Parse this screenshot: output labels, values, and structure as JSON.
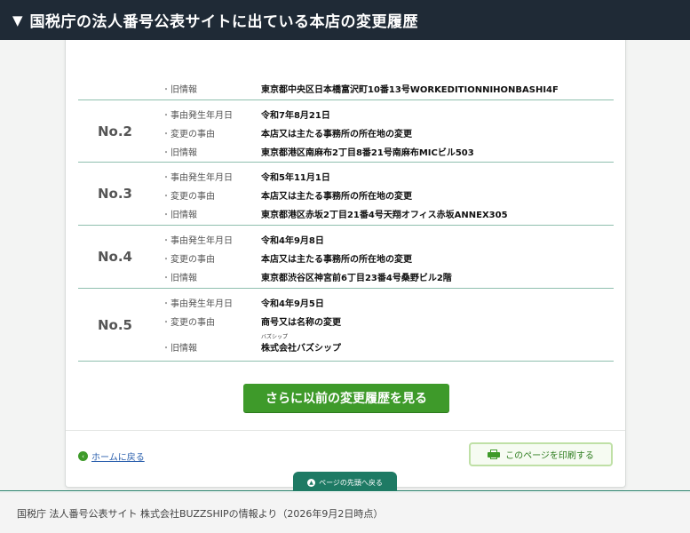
{
  "header": {
    "triangle": "▼",
    "title": "国税庁の法人番号公表サイトに出ている本店の変更履歴"
  },
  "records": [
    {
      "no": "",
      "fields": [
        {
          "label": "旧情報",
          "value": "東京都中央区日本橋富沢町10番13号WORKEDITIONNIHONBASHI4F"
        }
      ]
    },
    {
      "no": "No.2",
      "fields": [
        {
          "label": "事由発生年月日",
          "value": "令和7年8月21日"
        },
        {
          "label": "変更の事由",
          "value": "本店又は主たる事務所の所在地の変更"
        },
        {
          "label": "旧情報",
          "value": "東京都港区南麻布2丁目8番21号南麻布MICビル503"
        }
      ]
    },
    {
      "no": "No.3",
      "fields": [
        {
          "label": "事由発生年月日",
          "value": "令和5年11月1日"
        },
        {
          "label": "変更の事由",
          "value": "本店又は主たる事務所の所在地の変更"
        },
        {
          "label": "旧情報",
          "value": "東京都港区赤坂2丁目21番4号天翔オフィス赤坂ANNEX305"
        }
      ]
    },
    {
      "no": "No.4",
      "fields": [
        {
          "label": "事由発生年月日",
          "value": "令和4年9月8日"
        },
        {
          "label": "変更の事由",
          "value": "本店又は主たる事務所の所在地の変更"
        },
        {
          "label": "旧情報",
          "value": "東京都渋谷区神宮前6丁目23番4号桑野ビル2階"
        }
      ]
    },
    {
      "no": "No.5",
      "fields": [
        {
          "label": "事由発生年月日",
          "value": "令和4年9月5日"
        },
        {
          "label": "変更の事由",
          "value": "商号又は名称の変更"
        },
        {
          "label": "旧情報",
          "value": "株式会社バズシップ",
          "furigana": "バズシップ"
        }
      ]
    }
  ],
  "more_button": "さらに以前の変更履歴を見る",
  "home_link": "ホームに戻る",
  "print_button": "このページを印刷する",
  "page_top": "ページの先頭へ戻る",
  "caption": "国税庁 法人番号公表サイト 株式会社BUZZSHIPの情報より（2026年9月2日時点）",
  "bullet": "・",
  "icons": {
    "home": "‹",
    "page_top": "▲",
    "print": "printer-icon"
  }
}
